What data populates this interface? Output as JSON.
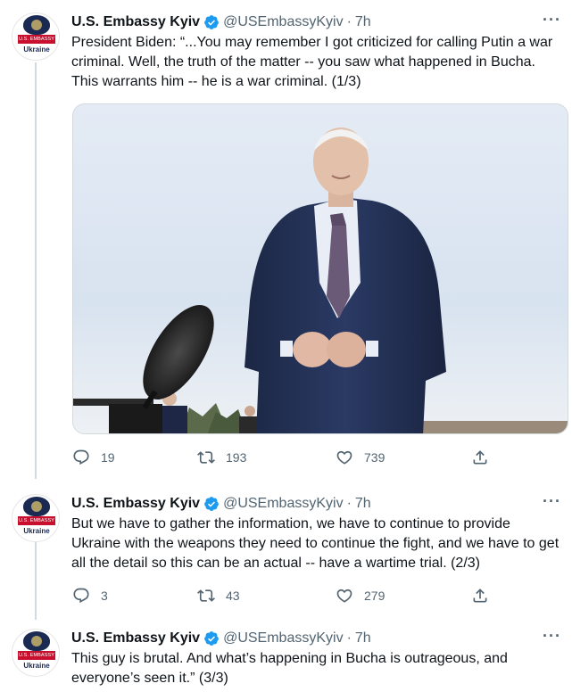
{
  "tweets": [
    {
      "avatar": {
        "banner": "U.S. EMBASSY",
        "country": "Ukraine"
      },
      "name": "U.S. Embassy Kyiv",
      "handle": "@USEmbassyKyiv",
      "separator": "·",
      "time": "7h",
      "text": "President Biden: “...You may remember I got criticized for calling Putin a war criminal. Well, the truth of the matter -- you saw what happened in Bucha. This warrants him -- he is a war criminal. (1/3)",
      "replies": "19",
      "retweets": "193",
      "likes": "739"
    },
    {
      "avatar": {
        "banner": "U.S. EMBASSY",
        "country": "Ukraine"
      },
      "name": "U.S. Embassy Kyiv",
      "handle": "@USEmbassyKyiv",
      "separator": "·",
      "time": "7h",
      "text": "But we have to gather the information, we have to continue to provide Ukraine with the weapons they need to continue the fight, and we have to get all the detail so this can be an actual -- have a wartime trial. (2/3)",
      "replies": "3",
      "retweets": "43",
      "likes": "279"
    },
    {
      "avatar": {
        "banner": "U.S. EMBASSY",
        "country": "Ukraine"
      },
      "name": "U.S. Embassy Kyiv",
      "handle": "@USEmbassyKyiv",
      "separator": "·",
      "time": "7h",
      "text": "This guy is brutal. And what’s happening in Bucha is outrageous, and everyone’s seen it.” (3/3)"
    }
  ],
  "colors": {
    "accent": "#1d9bf0",
    "muted": "#536471",
    "text": "#0f1419"
  },
  "icons": [
    "verified-badge-icon",
    "more-icon",
    "reply-icon",
    "retweet-icon",
    "like-icon",
    "share-icon"
  ]
}
